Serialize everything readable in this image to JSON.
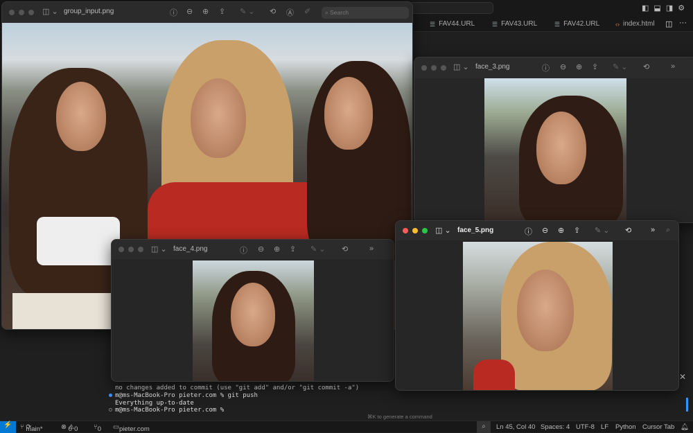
{
  "editor": {
    "tabs": [
      {
        "label": "FAV44.URL",
        "icon": "file-icon"
      },
      {
        "label": "FAV43.URL",
        "icon": "file-icon"
      },
      {
        "label": "FAV42.URL",
        "icon": "file-icon"
      },
      {
        "label": "index.html",
        "icon": "html-icon"
      }
    ],
    "terminal": {
      "lines": [
        "no changes added to commit (use \"git add\" and/or \"git commit -a\")",
        "m@ms-MacBook-Pro pieter.com % git push",
        "Everything up-to-date",
        "m@ms-MacBook-Pro pieter.com %"
      ],
      "hint": "⌘K to generate a command"
    },
    "status": {
      "branch": "main*",
      "errors": "0",
      "warnings": "0",
      "ports": "0",
      "folder": "pieter.com",
      "position": "Ln 45, Col 40",
      "spaces": "Spaces: 4",
      "encoding": "UTF-8",
      "eol": "LF",
      "language": "Python",
      "cursor_tab": "Cursor Tab"
    },
    "accent": "#0078d4"
  },
  "windows": {
    "group": {
      "title": "group_input.png",
      "search_placeholder": "Search"
    },
    "face3": {
      "title": "face_3.png"
    },
    "face4": {
      "title": "face_4.png"
    },
    "face5": {
      "title": "face_5.png"
    }
  }
}
